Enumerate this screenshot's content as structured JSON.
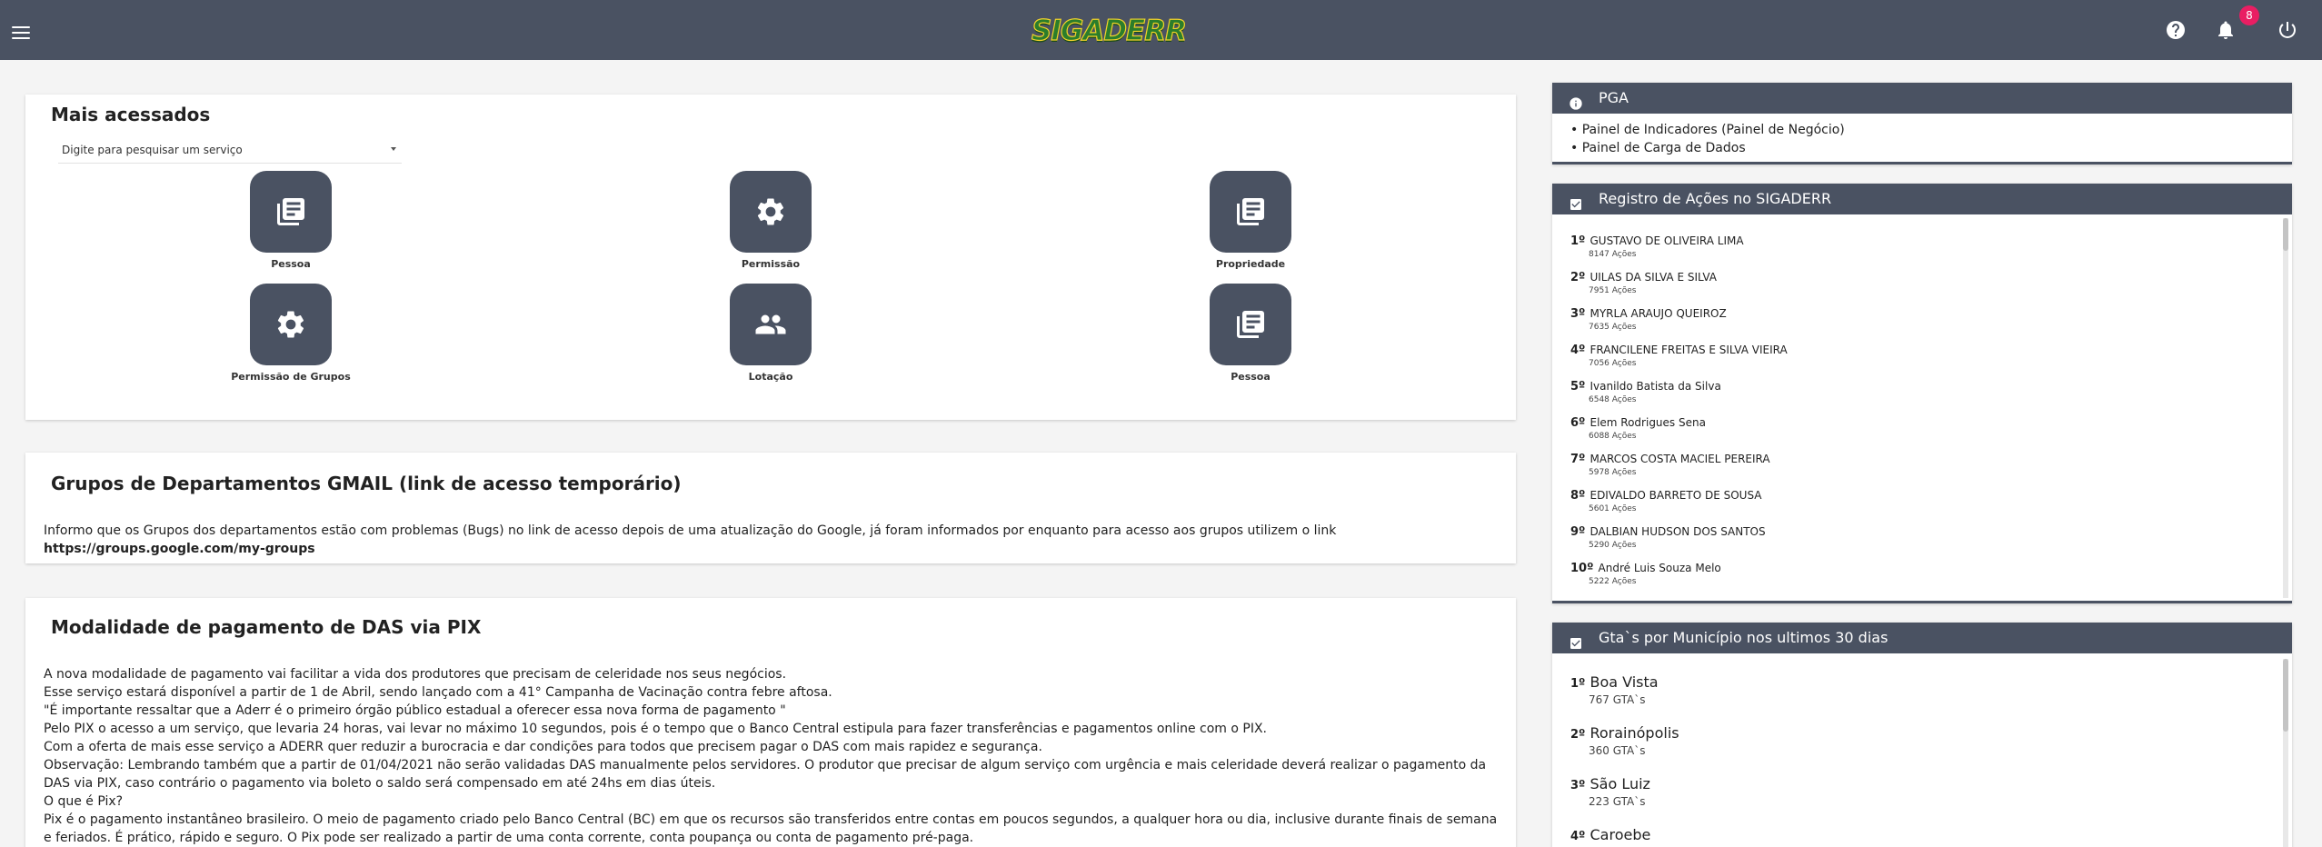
{
  "header": {
    "logo_text": "SIGADERR",
    "notification_count": "8",
    "icons": [
      "menu-icon",
      "help-icon",
      "bell-icon",
      "power-icon"
    ]
  },
  "mais_acessados": {
    "title": "Mais acessados",
    "search_placeholder": "Digite para pesquisar um serviço",
    "tiles": [
      {
        "label": "Pessoa",
        "icon": "list-document-icon"
      },
      {
        "label": "Permissão",
        "icon": "gear-icon"
      },
      {
        "label": "Propriedade",
        "icon": "list-document-icon"
      },
      {
        "label": "Permissão de Grupos",
        "icon": "gear-icon"
      },
      {
        "label": "Lotação",
        "icon": "people-icon"
      },
      {
        "label": "Pessoa",
        "icon": "list-document-icon"
      }
    ]
  },
  "grupos": {
    "title": "Grupos de Departamentos GMAIL (link de acesso temporário)",
    "text": "Informo que os Grupos dos departamentos estão com problemas (Bugs) no link de acesso depois de uma atualização do Google, já foram informados por enquanto para acesso aos grupos utilizem o link",
    "link": "https://groups.google.com/my-groups"
  },
  "pix": {
    "title": "Modalidade de pagamento de DAS via PIX",
    "lines": [
      "A nova modalidade de pagamento vai facilitar a vida dos produtores que precisam de celeridade nos seus negócios.",
      "Esse serviço estará disponível a partir de 1 de Abril, sendo lançado com a 41° Campanha de Vacinação contra febre aftosa.",
      "\"É importante ressaltar que a Aderr é o primeiro órgão público estadual a oferecer essa nova forma de pagamento \"",
      "Pelo PIX o acesso a um serviço, que levaria 24 horas, vai levar no máximo 10 segundos, pois é o tempo que o Banco Central estipula para fazer transferências e pagamentos online com o PIX.",
      "Com a oferta de mais esse serviço a ADERR quer reduzir a burocracia e dar condições para todos que precisem pagar o DAS com mais rapidez e segurança.",
      "Observação: Lembrando também que a partir de 01/04/2021 não serão validadas DAS manualmente pelos servidores. O produtor que precisar de algum serviço com urgência e mais celeridade deverá realizar o pagamento da",
      "DAS via PIX, caso contrário o pagamento via boleto o saldo será compensado em até 24hs em dias úteis.",
      "O que é Pix?",
      "Pix é o pagamento instantâneo brasileiro. O meio de pagamento criado pelo Banco Central (BC) em que os recursos são transferidos entre contas em poucos segundos, a qualquer hora ou dia, inclusive durante finais de semana",
      "e feriados. É prático, rápido e seguro. O Pix pode ser realizado a partir de uma conta corrente, conta poupança ou conta de pagamento pré-paga."
    ]
  },
  "pga": {
    "title": "PGA",
    "items": [
      "Painel de Indicadores (Painel de Negócio)",
      "Painel de Carga de Dados"
    ]
  },
  "registro": {
    "title": "Registro de Ações no SIGADERR",
    "rows": [
      {
        "rank": "1º",
        "name": "GUSTAVO DE OLIVEIRA LIMA",
        "actions": "8147 Ações"
      },
      {
        "rank": "2º",
        "name": "UILAS DA SILVA E SILVA",
        "actions": "7951 Ações"
      },
      {
        "rank": "3º",
        "name": "MYRLA ARAUJO QUEIROZ",
        "actions": "7635 Ações"
      },
      {
        "rank": "4º",
        "name": "FRANCILENE FREITAS E SILVA VIEIRA",
        "actions": "7056 Ações"
      },
      {
        "rank": "5º",
        "name": "Ivanildo Batista da Silva",
        "actions": "6548 Ações"
      },
      {
        "rank": "6º",
        "name": "Elem Rodrigues Sena",
        "actions": "6088 Ações"
      },
      {
        "rank": "7º",
        "name": "MARCOS COSTA MACIEL PEREIRA",
        "actions": "5978 Ações"
      },
      {
        "rank": "8º",
        "name": "EDIVALDO BARRETO DE SOUSA",
        "actions": "5601 Ações"
      },
      {
        "rank": "9º",
        "name": "DALBIAN HUDSON DOS SANTOS",
        "actions": "5290 Ações"
      },
      {
        "rank": "10º",
        "name": "André Luis Souza Melo",
        "actions": "5222 Ações"
      }
    ]
  },
  "gta": {
    "title": "Gta`s por Município nos ultimos 30 dias",
    "rows": [
      {
        "rank": "1º",
        "name": "Boa Vista",
        "count": "767 GTA`s"
      },
      {
        "rank": "2º",
        "name": "Rorainópolis",
        "count": "360 GTA`s"
      },
      {
        "rank": "3º",
        "name": "São Luiz",
        "count": "223 GTA`s"
      },
      {
        "rank": "4º",
        "name": "Caroebe",
        "count": ""
      }
    ]
  },
  "colors": {
    "topbar": "#4a5262",
    "badge": "#e91e63",
    "tile": "#4a5262"
  }
}
